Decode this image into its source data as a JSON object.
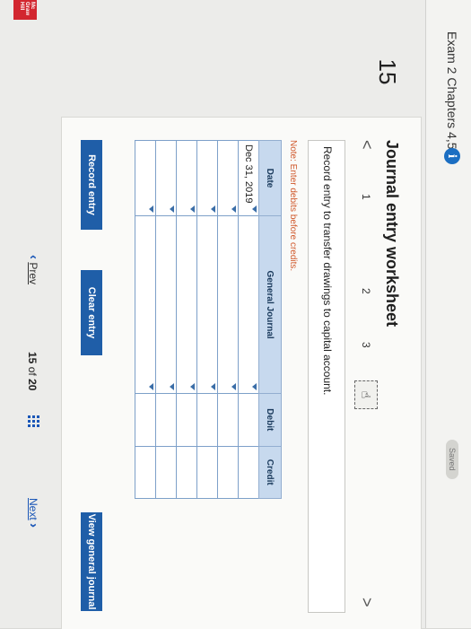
{
  "header": {
    "exam_title": "Exam 2 Chapters 4,5,6",
    "info_glyph": "i",
    "saved_label": "Saved"
  },
  "question_number": "15",
  "logo_text": "Mc Graw Hill Education",
  "worksheet": {
    "title": "Journal entry worksheet",
    "prev_arrow": "<",
    "next_arrow": ">",
    "steps": [
      "1",
      "2",
      "3"
    ],
    "active_step_icon": "hand-pointer-icon",
    "instruction": "Record entry to transfer drawings to capital account.",
    "note": "Note: Enter debits before credits.",
    "table": {
      "headers": [
        "Date",
        "General Journal",
        "Debit",
        "Credit"
      ],
      "rows": [
        [
          "Dec 31, 2019",
          "",
          "",
          ""
        ],
        [
          "",
          "",
          "",
          ""
        ],
        [
          "",
          "",
          "",
          ""
        ],
        [
          "",
          "",
          "",
          ""
        ],
        [
          "",
          "",
          "",
          ""
        ],
        [
          "",
          "",
          "",
          ""
        ]
      ]
    },
    "buttons": {
      "record": "Record entry",
      "clear": "Clear entry",
      "view_journal": "View general journal"
    }
  },
  "footer": {
    "prev_label": "Prev",
    "current_page": "15",
    "of_label": "of",
    "total_pages": "20",
    "next_label": "Next"
  }
}
